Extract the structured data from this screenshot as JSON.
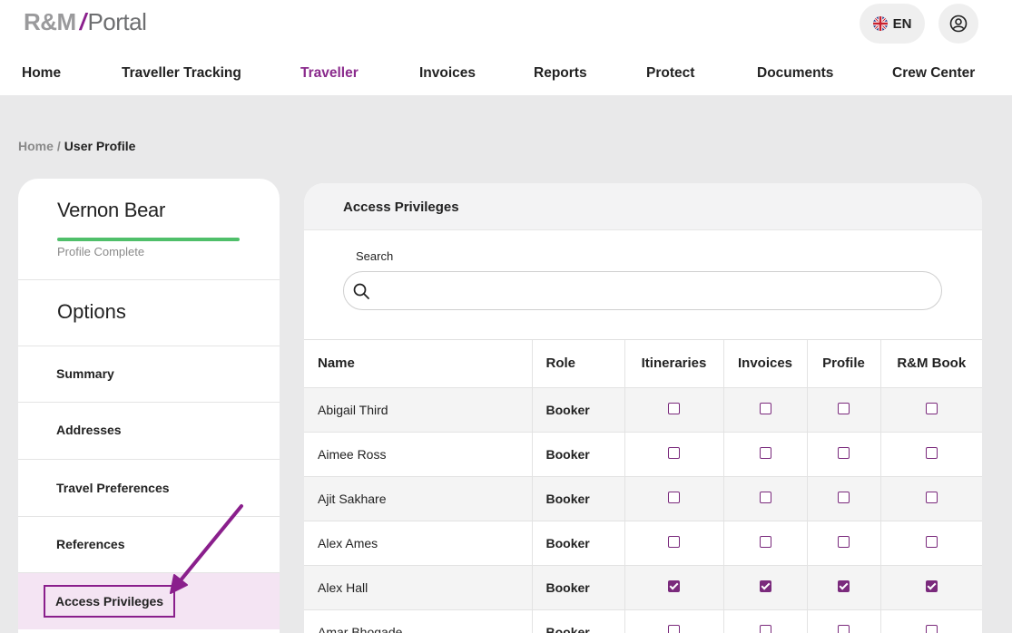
{
  "header": {
    "logo": {
      "left": "R&M",
      "slash": "/",
      "right": "Portal"
    },
    "language": {
      "code": "EN",
      "flag_icon": "uk-flag-icon"
    },
    "user_icon": "user-circle-icon"
  },
  "nav": {
    "items": [
      {
        "label": "Home"
      },
      {
        "label": "Traveller Tracking"
      },
      {
        "label": "Traveller",
        "active": true
      },
      {
        "label": "Invoices"
      },
      {
        "label": "Reports"
      },
      {
        "label": "Protect"
      },
      {
        "label": "Documents"
      },
      {
        "label": "Crew Center"
      }
    ]
  },
  "breadcrumb": {
    "home": "Home",
    "separator": "/",
    "current": "User Profile"
  },
  "profile": {
    "name": "Vernon Bear",
    "status": "Profile Complete",
    "completion": 1.0
  },
  "options": {
    "title": "Options",
    "items": [
      {
        "label": "Summary"
      },
      {
        "label": "Addresses"
      },
      {
        "label": "Travel Preferences"
      },
      {
        "label": "References"
      },
      {
        "label": "Access Privileges",
        "active": true
      }
    ]
  },
  "access_privileges": {
    "title": "Access Privileges",
    "search": {
      "label": "Search",
      "value": "",
      "placeholder": ""
    },
    "columns": [
      "Name",
      "Role",
      "Itineraries",
      "Invoices",
      "Profile",
      "R&M Book"
    ],
    "rows": [
      {
        "name": "Abigail Third",
        "role": "Booker",
        "itineraries": false,
        "invoices": false,
        "profile": false,
        "rm_book": false
      },
      {
        "name": "Aimee Ross",
        "role": "Booker",
        "itineraries": false,
        "invoices": false,
        "profile": false,
        "rm_book": false
      },
      {
        "name": "Ajit Sakhare",
        "role": "Booker",
        "itineraries": false,
        "invoices": false,
        "profile": false,
        "rm_book": false
      },
      {
        "name": "Alex Ames",
        "role": "Booker",
        "itineraries": false,
        "invoices": false,
        "profile": false,
        "rm_book": false
      },
      {
        "name": "Alex Hall",
        "role": "Booker",
        "itineraries": true,
        "invoices": true,
        "profile": true,
        "rm_book": true
      },
      {
        "name": "Amar Bhogade",
        "role": "Booker",
        "itineraries": false,
        "invoices": false,
        "profile": false,
        "rm_book": false
      }
    ]
  },
  "colors": {
    "accent": "#8a1f8c",
    "progress": "#4fbf6a",
    "active_bg": "#f4e4f3"
  }
}
